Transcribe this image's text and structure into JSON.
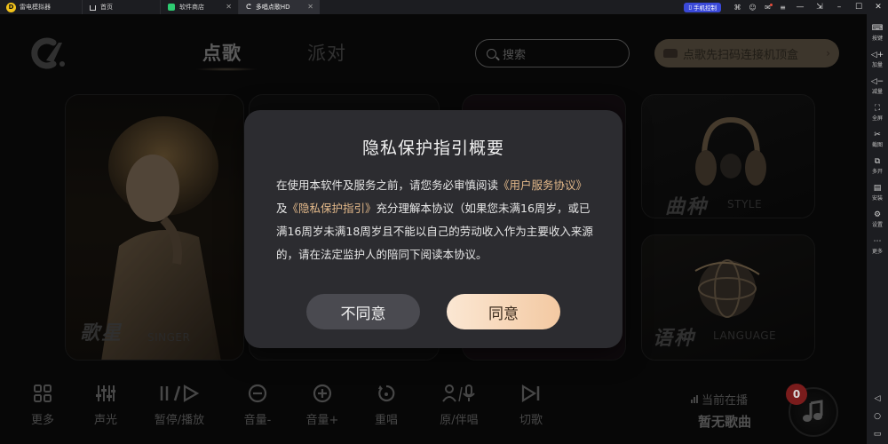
{
  "titlebar": {
    "app_name": "雷电模拟器",
    "tabs": [
      {
        "label": "首页",
        "icon": "home-icon"
      },
      {
        "label": "软件商店",
        "icon": "store-icon"
      },
      {
        "label": "多唱点歌HD",
        "icon": "karaoke-icon",
        "active": true
      }
    ],
    "phone_control": "手机控制"
  },
  "sidebar": {
    "items": [
      {
        "label": "按键",
        "icon": "keyboard-icon"
      },
      {
        "label": "加量",
        "icon": "volume-up-icon"
      },
      {
        "label": "减量",
        "icon": "volume-down-icon"
      },
      {
        "label": "全屏",
        "icon": "fullscreen-icon"
      },
      {
        "label": "截图",
        "icon": "scissors-icon"
      },
      {
        "label": "多开",
        "icon": "multi-instance-icon"
      },
      {
        "label": "安装",
        "icon": "apk-install-icon"
      },
      {
        "label": "设置",
        "icon": "settings-icon"
      },
      {
        "label": "更多",
        "icon": "more-icon"
      }
    ]
  },
  "app": {
    "nav": {
      "songs": "点歌",
      "party": "派对"
    },
    "search_placeholder": "搜索",
    "scan_banner": "点歌先扫码连接机顶盒",
    "cards": {
      "singer": {
        "title": "歌星",
        "subtitle": "SINGER"
      },
      "style": {
        "title": "曲种",
        "subtitle": "STYLE"
      },
      "language": {
        "title": "语种",
        "subtitle": "LANGUAGE"
      }
    },
    "controls": [
      {
        "label": "更多",
        "icon": "grid-icon"
      },
      {
        "label": "声光",
        "icon": "equalizer-icon"
      },
      {
        "label": "暂停/播放",
        "icon": "pause-play-icon"
      },
      {
        "label": "音量-",
        "icon": "volume-minus-icon"
      },
      {
        "label": "音量+",
        "icon": "volume-plus-icon"
      },
      {
        "label": "重唱",
        "icon": "replay-icon"
      },
      {
        "label": "原/伴唱",
        "icon": "vocal-switch-icon"
      },
      {
        "label": "切歌",
        "icon": "next-song-icon"
      }
    ],
    "now_playing_label": "当前在播",
    "now_playing_value": "暂无歌曲",
    "queue_count": "0"
  },
  "modal": {
    "title": "隐私保护指引概要",
    "body_1": "在使用本软件及服务之前，请您务必审慎阅读",
    "link_1": "《用户服务协议》",
    "body_2": "及",
    "link_2": "《隐私保护指引》",
    "body_3": "充分理解本协议（如果您未满16周岁，或已满16周岁未满18周岁且不能以自己的劳动收入作为主要收入来源的，请在法定监护人的陪同下阅读本协议。",
    "disagree": "不同意",
    "agree": "同意"
  },
  "colors": {
    "accent_gold": "#e3b98a",
    "agree_button": "#f3c9a2",
    "modal_bg": "#2c2c30",
    "phone_control": "#3a49d8"
  }
}
